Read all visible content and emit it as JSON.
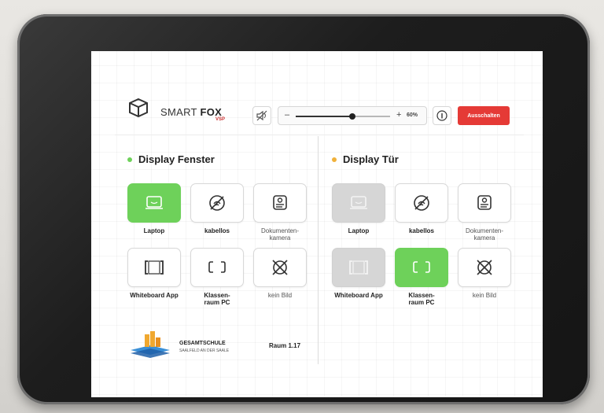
{
  "header": {
    "brand_light": "SMART ",
    "brand_bold": "FOX",
    "brand_sub": "VSP",
    "volume": {
      "minus": "–",
      "plus": "+",
      "percent_label": "60%",
      "level": 0.6
    },
    "off_button": "Ausschalten",
    "colors": {
      "off_button": "#e53a36"
    }
  },
  "panels": [
    {
      "title": "Display Fenster",
      "dot_color": "#6ed15a",
      "tiles": [
        {
          "label": "Laptop",
          "icon": "laptop-icon",
          "state": "active"
        },
        {
          "label": "kabellos",
          "icon": "wireless-off-icon",
          "state": "normal"
        },
        {
          "label": "Dokumenten-\nkamera",
          "icon": "document-camera-icon",
          "state": "normal"
        },
        {
          "label": "Whiteboard App",
          "icon": "whiteboard-icon",
          "state": "normal"
        },
        {
          "label": "Klassen-\nraum PC",
          "icon": "monitor-icon",
          "state": "normal"
        },
        {
          "label": "kein Bild",
          "icon": "no-image-icon",
          "state": "normal"
        }
      ]
    },
    {
      "title": "Display Tür",
      "dot_color": "#f0b13a",
      "tiles": [
        {
          "label": "Laptop",
          "icon": "laptop-icon",
          "state": "disabled"
        },
        {
          "label": "kabellos",
          "icon": "wireless-off-icon",
          "state": "normal"
        },
        {
          "label": "Dokumenten-\nkamera",
          "icon": "document-camera-icon",
          "state": "normal"
        },
        {
          "label": "Whiteboard App",
          "icon": "whiteboard-icon",
          "state": "disabled"
        },
        {
          "label": "Klassen-\nraum PC",
          "icon": "monitor-icon",
          "state": "active"
        },
        {
          "label": "kein Bild",
          "icon": "no-image-icon",
          "state": "normal"
        }
      ]
    }
  ],
  "footer": {
    "school_name": "GESAMTSCHULE",
    "school_sub": "SAALFELD AN DER SAALE",
    "room": "Raum 1.17"
  }
}
